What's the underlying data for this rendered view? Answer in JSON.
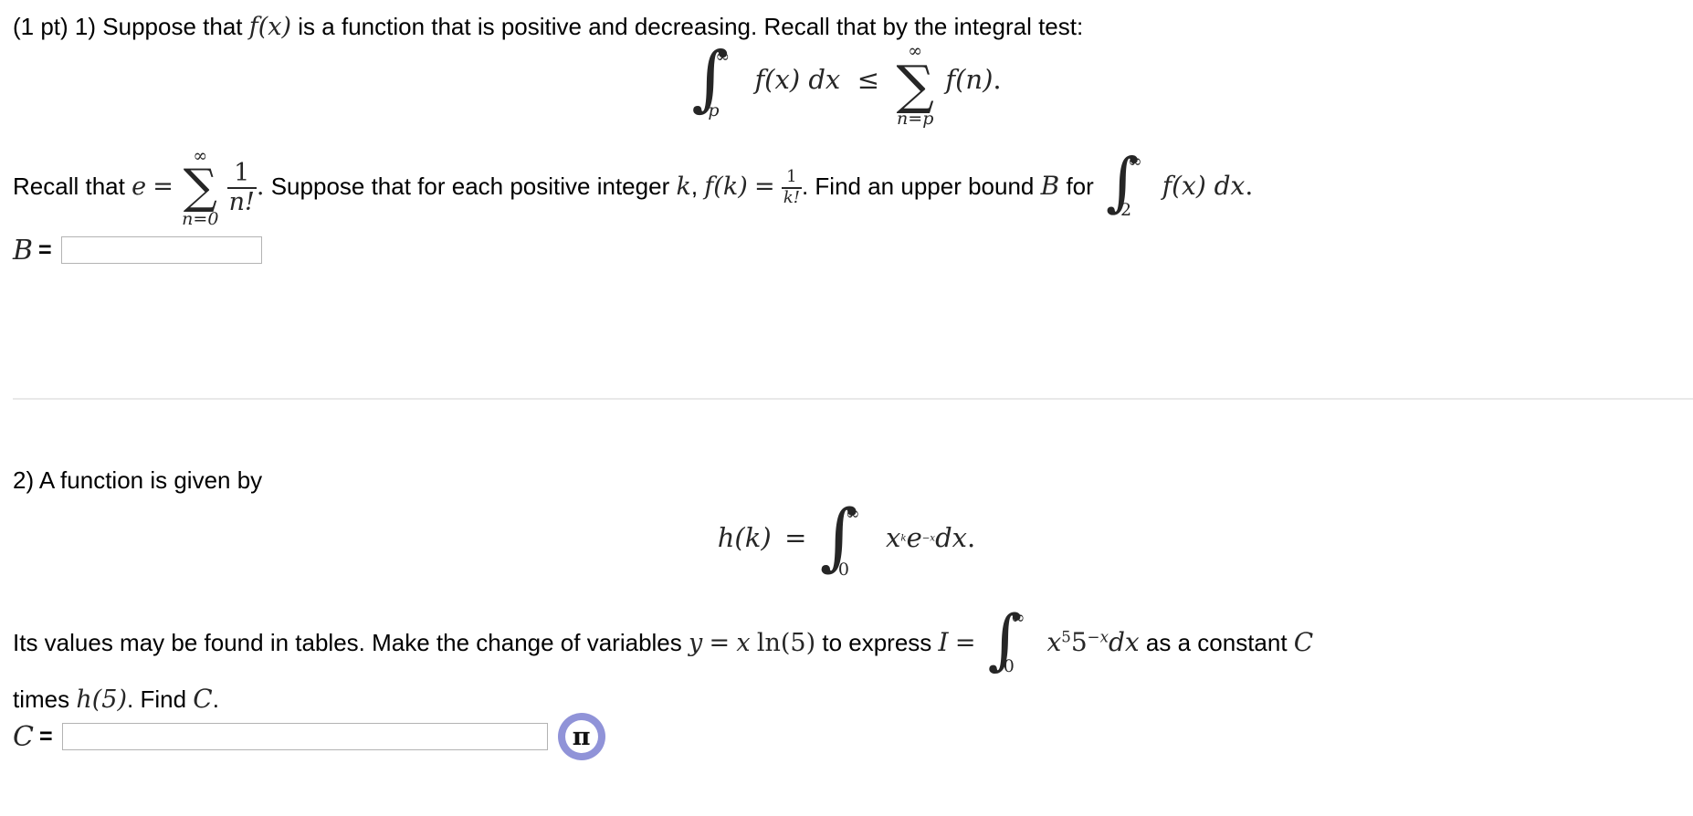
{
  "problem1": {
    "points_label": "(1 pt)",
    "number": "1)",
    "intro_a": "Suppose that",
    "fx": "f(x)",
    "intro_b": "is a function that is positive and decreasing. Recall that by the integral test:",
    "display_equation": {
      "integral_lower": "p",
      "integral_upper": "∞",
      "integrand": "f(x) dx",
      "relation": "≤",
      "sum_lower": "n=p",
      "sum_upper": "∞",
      "summand": "f(n)",
      "period": "."
    },
    "recall_a": "Recall that",
    "e_symbol": "e",
    "equals": "=",
    "series": {
      "lower": "n=0",
      "upper": "∞",
      "num": "1",
      "den": "n!"
    },
    "recall_period": ".",
    "recall_b": "Suppose that for each positive integer",
    "k_symbol": "k",
    "comma": ",",
    "fk": "f(k)",
    "fk_value_num": "1",
    "fk_value_den": "k!",
    "recall_c": ". Find an upper bound",
    "B_symbol": "B",
    "recall_d": "for",
    "bound_integral": {
      "lower": "2",
      "upper": "∞",
      "integrand": "f(x) dx",
      "period": "."
    },
    "answer_label": "B",
    "answer_equals": "=",
    "answer_value": "",
    "answer_placeholder": ""
  },
  "problem2": {
    "number": "2)",
    "intro": "A function is given by",
    "display_equation": {
      "lhs": "h(k)",
      "equals": "=",
      "integral_lower": "0",
      "integral_upper": "∞",
      "integrand_base": "x",
      "integrand_exp": "k",
      "integrand_e": "e",
      "integrand_e_exp": "−x",
      "differential": "dx",
      "period": "."
    },
    "body_a": "Its values may be found in tables. Make the change of variables",
    "substitution_y": "y",
    "substitution_eq": "=",
    "substitution_x": "x",
    "substitution_ln": "ln(5)",
    "body_b": "to express",
    "I_symbol": "I",
    "I_equals": "=",
    "I_integral": {
      "lower": "0",
      "upper": "∞",
      "x": "x",
      "x_exp": "5",
      "five": "5",
      "five_exp": "−x",
      "differential": "dx"
    },
    "body_c": "as a constant",
    "C_symbol": "C",
    "body_d": "times",
    "h5": "h(5)",
    "body_e": ". Find",
    "C_symbol_2": "C",
    "body_f": ".",
    "answer_label": "C",
    "answer_equals": "=",
    "answer_value": "",
    "answer_placeholder": "",
    "pi_button_glyph": "π",
    "pi_button_name": "math-palette-pi-button"
  },
  "colors": {
    "pi_ring": "#9093d8",
    "input_border": "#b3b3b3",
    "divider": "#e9e9e9",
    "math_text": "#262626",
    "prose_text": "#000000"
  }
}
